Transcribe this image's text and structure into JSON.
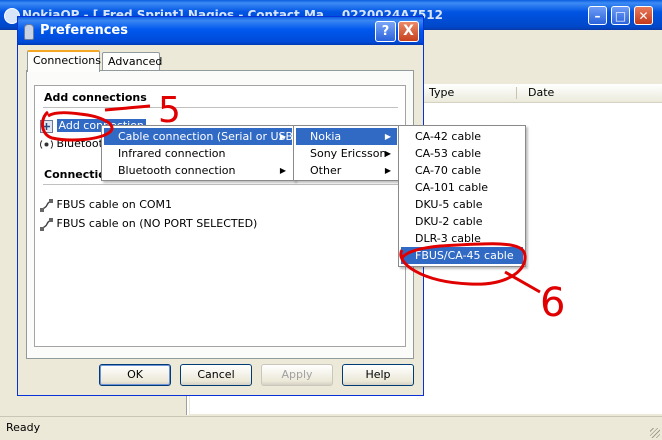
{
  "background_window": {
    "title": "NokiaOP - [ Fred Sprint] Nagios - Contact Ma... 0220024A7512",
    "list_headers": [
      "Type",
      "Date"
    ],
    "status": "Ready"
  },
  "dialog": {
    "title": "Preferences",
    "help_glyph": "?",
    "close_glyph": "X",
    "tabs": [
      {
        "label": "Connections",
        "active": true
      },
      {
        "label": "Advanced",
        "active": false
      }
    ],
    "add_connections_header": "Add connections",
    "add_items": [
      {
        "label": "Add connection",
        "icon": "add-connection-icon"
      },
      {
        "label": "Bluetooth",
        "icon": "bluetooth-icon"
      }
    ],
    "connections_header": "Connections",
    "connections": [
      {
        "label": "FBUS cable on COM1",
        "icon": "cable-icon"
      },
      {
        "label": "FBUS cable on (NO PORT SELECTED)",
        "icon": "cable-icon"
      }
    ],
    "buttons": {
      "ok": "OK",
      "cancel": "Cancel",
      "apply": "Apply",
      "help": "Help"
    }
  },
  "menus": {
    "connection_type": [
      {
        "label": "Cable connection (Serial or USB)",
        "highlighted": true,
        "submenu": true
      },
      {
        "label": "Infrared connection",
        "highlighted": false,
        "submenu": false
      },
      {
        "label": "Bluetooth connection",
        "highlighted": false,
        "submenu": true
      }
    ],
    "manufacturer": [
      {
        "label": "Nokia",
        "highlighted": true,
        "submenu": true
      },
      {
        "label": "Sony Ericsson",
        "highlighted": false,
        "submenu": true
      },
      {
        "label": "Other",
        "highlighted": false,
        "submenu": true
      }
    ],
    "cable": [
      {
        "label": "CA-42 cable",
        "highlighted": false
      },
      {
        "label": "CA-53 cable",
        "highlighted": false
      },
      {
        "label": "CA-70 cable",
        "highlighted": false
      },
      {
        "label": "CA-101 cable",
        "highlighted": false
      },
      {
        "label": "DKU-5 cable",
        "highlighted": false
      },
      {
        "label": "DKU-2 cable",
        "highlighted": false
      },
      {
        "label": "DLR-3 cable",
        "highlighted": false
      },
      {
        "label": "FBUS/CA-45 cable",
        "highlighted": true
      }
    ]
  },
  "annotations": {
    "step_a": "5",
    "step_b": "6",
    "color": "#e00000"
  },
  "colors": {
    "titlebar": "#0054e3",
    "selection": "#316ac5",
    "dialog_bg": "#ece9d8"
  }
}
